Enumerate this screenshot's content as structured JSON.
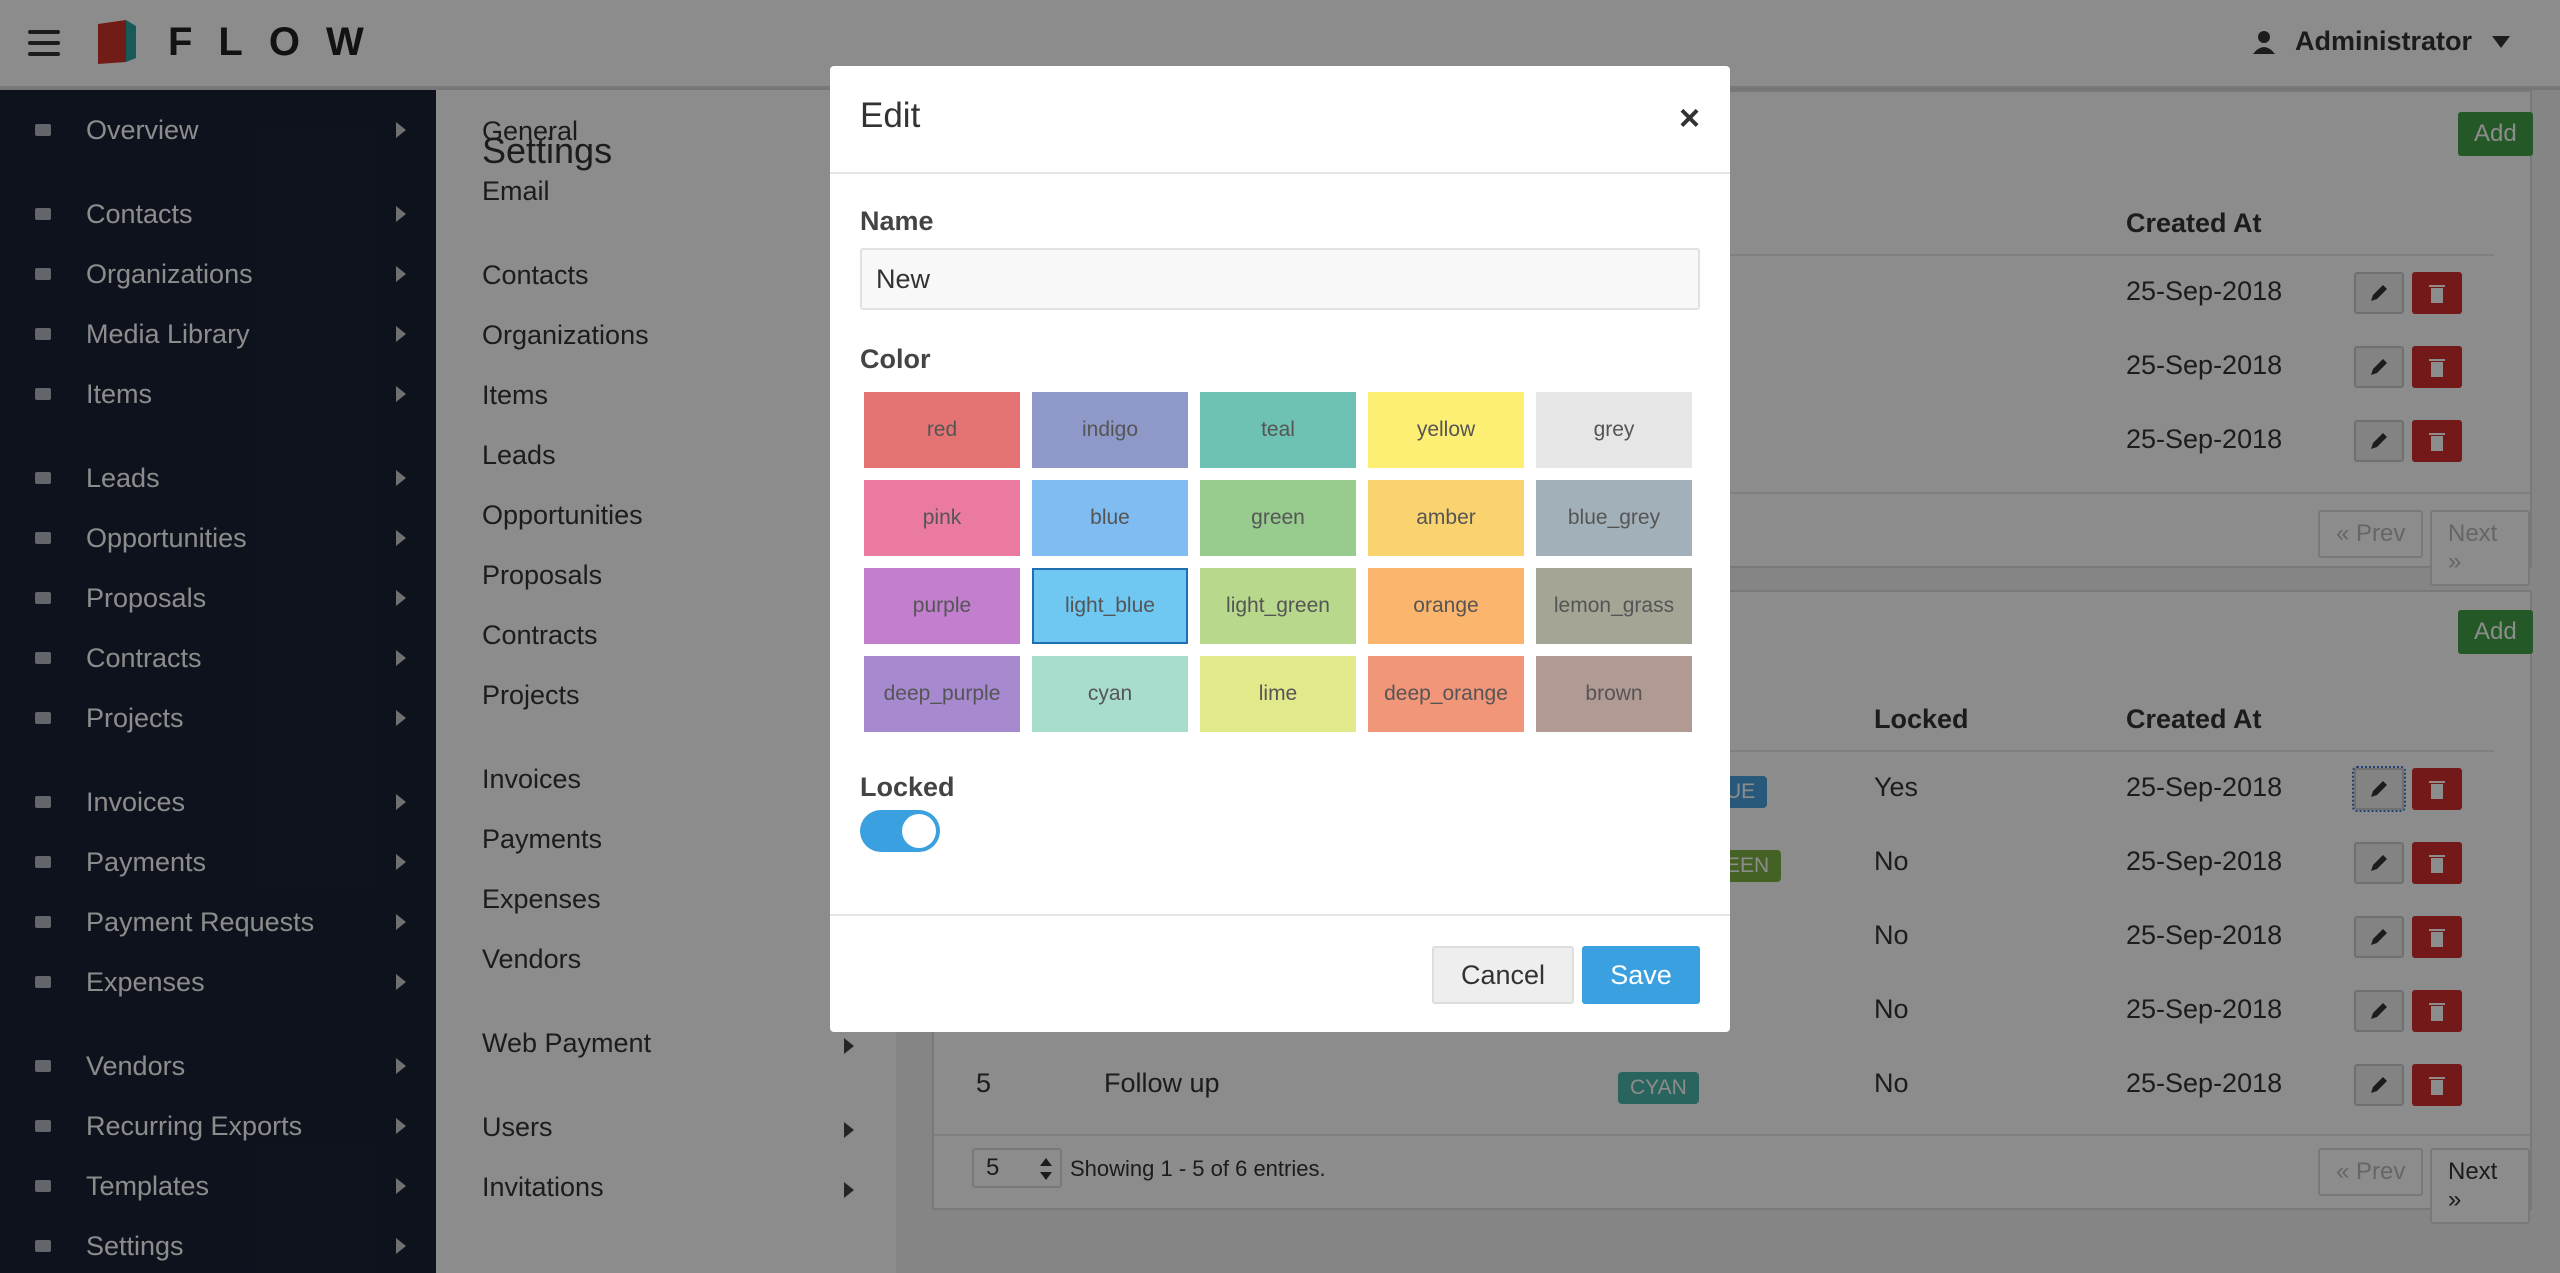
{
  "app": {
    "brand": "FLOW",
    "user": "Administrator"
  },
  "sidebar": {
    "items": [
      {
        "label": "Overview",
        "icon": "home-icon"
      },
      {
        "label": "Contacts",
        "icon": "users-icon"
      },
      {
        "label": "Organizations",
        "icon": "briefcase-icon"
      },
      {
        "label": "Media Library",
        "icon": "image-icon"
      },
      {
        "label": "Items",
        "icon": "cube-icon"
      },
      {
        "label": "Leads",
        "icon": "funnel-icon"
      },
      {
        "label": "Opportunities",
        "icon": "bolt-icon"
      },
      {
        "label": "Proposals",
        "icon": "document-icon"
      },
      {
        "label": "Contracts",
        "icon": "hand-icon"
      },
      {
        "label": "Projects",
        "icon": "t-icon"
      },
      {
        "label": "Invoices",
        "icon": "invoice-icon"
      },
      {
        "label": "Payments",
        "icon": "card-icon"
      },
      {
        "label": "Payment Requests",
        "icon": "send-icon"
      },
      {
        "label": "Expenses",
        "icon": "money-icon"
      },
      {
        "label": "Vendors",
        "icon": "vendors-icon"
      },
      {
        "label": "Recurring Exports",
        "icon": "refresh-icon"
      },
      {
        "label": "Templates",
        "icon": "folder-icon"
      },
      {
        "label": "Settings",
        "icon": "wrench-icon"
      }
    ]
  },
  "settings": {
    "title": "Settings",
    "items": [
      "General",
      "Email",
      "Contacts",
      "Organizations",
      "Items",
      "Leads",
      "Opportunities",
      "Proposals",
      "Contracts",
      "Projects",
      "Invoices",
      "Payments",
      "Expenses",
      "Vendors",
      "Web Payment",
      "Users",
      "Invitations"
    ]
  },
  "top_card": {
    "add_label": "Add",
    "header_created": "Created At",
    "rows": [
      "25-Sep-2018",
      "25-Sep-2018",
      "25-Sep-2018"
    ],
    "prev": "« Prev",
    "next": "Next »"
  },
  "bottom_card": {
    "add_label": "Add",
    "header_locked": "Locked",
    "header_created": "Created At",
    "rows": [
      {
        "badge": "UE",
        "locked": "Yes",
        "created": "25-Sep-2018"
      },
      {
        "badge": "EEN",
        "locked": "No",
        "created": "25-Sep-2018"
      },
      {
        "badge": "",
        "locked": "No",
        "created": "25-Sep-2018"
      },
      {
        "badge": "",
        "locked": "No",
        "created": "25-Sep-2018"
      },
      {
        "num": "5",
        "name": "Follow up",
        "badge": "CYAN",
        "locked": "No",
        "created": "25-Sep-2018"
      }
    ],
    "page_size": "5",
    "showing": "Showing 1 - 5 of 6 entries.",
    "prev": "« Prev",
    "next": "Next »"
  },
  "modal": {
    "title": "Edit",
    "close": "×",
    "name_label": "Name",
    "name_value": "New",
    "color_label": "Color",
    "colors": [
      {
        "name": "red",
        "hex": "#e57373"
      },
      {
        "name": "indigo",
        "hex": "#8e99c9"
      },
      {
        "name": "teal",
        "hex": "#6dc2b4"
      },
      {
        "name": "yellow",
        "hex": "#fdef73"
      },
      {
        "name": "grey",
        "hex": "#e6e6e6"
      },
      {
        "name": "pink",
        "hex": "#eb7aa1"
      },
      {
        "name": "blue",
        "hex": "#7ebcf2"
      },
      {
        "name": "green",
        "hex": "#98cc8f"
      },
      {
        "name": "amber",
        "hex": "#fbd36e"
      },
      {
        "name": "blue_grey",
        "hex": "#a2b1b9"
      },
      {
        "name": "purple",
        "hex": "#c27fcd"
      },
      {
        "name": "light_blue",
        "hex": "#6ec8f1"
      },
      {
        "name": "light_green",
        "hex": "#b8d98c"
      },
      {
        "name": "orange",
        "hex": "#fbb56c"
      },
      {
        "name": "lemon_grass",
        "hex": "#a5a596"
      },
      {
        "name": "deep_purple",
        "hex": "#a689cf"
      },
      {
        "name": "cyan",
        "hex": "#a8dccd"
      },
      {
        "name": "lime",
        "hex": "#e2e98a"
      },
      {
        "name": "deep_orange",
        "hex": "#f2967a"
      },
      {
        "name": "brown",
        "hex": "#b09a93"
      }
    ],
    "selected_color": "light_blue",
    "locked_label": "Locked",
    "locked": true,
    "cancel_label": "Cancel",
    "save_label": "Save"
  }
}
